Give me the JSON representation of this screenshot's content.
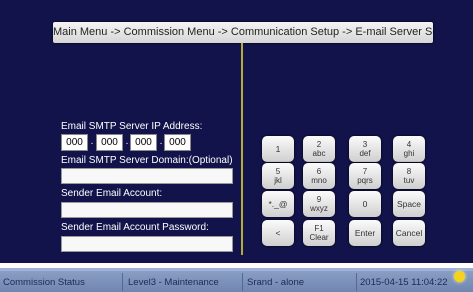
{
  "breadcrumb": "Main Menu -> Commission Menu -> Communication Setup -> E-mail Server Setup",
  "form": {
    "ip_label": "Email SMTP Server IP Address:",
    "ip_octets": [
      "000",
      "000",
      "000",
      "000"
    ],
    "ip_separator": ".",
    "domain_label": "Email SMTP Server Domain:(Optional)",
    "domain_value": "",
    "sender_label": "Sender Email Account:",
    "sender_value": "",
    "password_label": "Sender Email Account Password:",
    "password_value": ""
  },
  "keypad": {
    "k1": {
      "main": "1",
      "sub": ""
    },
    "k2": {
      "main": "2",
      "sub": "abc"
    },
    "k3": {
      "main": "3",
      "sub": "def"
    },
    "k4": {
      "main": "4",
      "sub": "ghi"
    },
    "k5": {
      "main": "5",
      "sub": "jkl"
    },
    "k6": {
      "main": "6",
      "sub": "mno"
    },
    "k7": {
      "main": "7",
      "sub": "pqrs"
    },
    "k8": {
      "main": "8",
      "sub": "tuv"
    },
    "ksym": {
      "main": "*._@",
      "sub": ""
    },
    "k9": {
      "main": "9",
      "sub": "wxyz"
    },
    "k0": {
      "main": "0",
      "sub": ""
    },
    "space": {
      "main": "Space",
      "sub": ""
    },
    "back": {
      "main": "<",
      "sub": ""
    },
    "f1": {
      "main": "F1",
      "sub": "Clear"
    },
    "enter": {
      "main": "Enter",
      "sub": ""
    },
    "cancel": {
      "main": "Cancel",
      "sub": ""
    }
  },
  "statusbar": {
    "status": "Commission Status",
    "level": "Level3 - Maintenance",
    "mode": "Srand - alone",
    "datetime": "2015-04-15 11:04:22",
    "indicator_color": "#f7d21a"
  }
}
